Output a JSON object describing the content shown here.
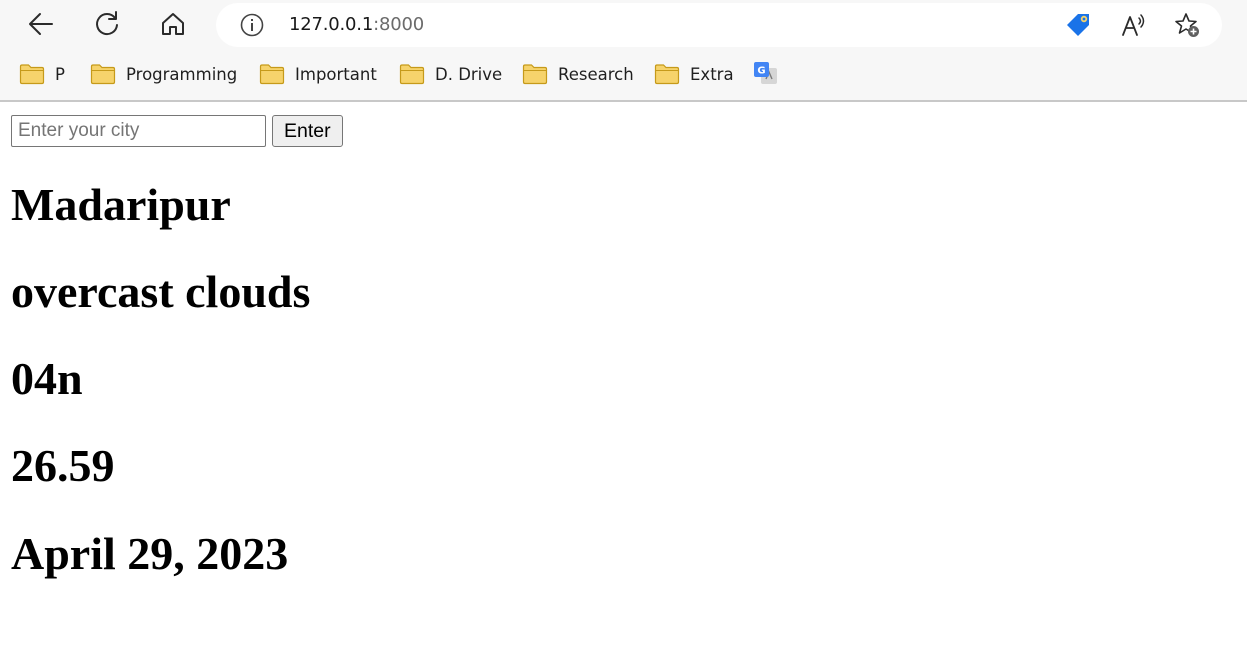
{
  "browser": {
    "url_host": "127.0.0.1",
    "url_port": ":8000",
    "bookmarks": [
      {
        "label": "P",
        "icon": "folder-icon"
      },
      {
        "label": "Programming",
        "icon": "folder-icon"
      },
      {
        "label": "Important",
        "icon": "folder-icon"
      },
      {
        "label": "D. Drive",
        "icon": "folder-icon"
      },
      {
        "label": "Research",
        "icon": "folder-icon"
      },
      {
        "label": "Extra",
        "icon": "folder-icon"
      }
    ],
    "colors": {
      "tag_blue": "#1A73E8",
      "folder_yellow": "#F6D36B",
      "folder_border": "#C69A1A"
    }
  },
  "form": {
    "city_placeholder": "Enter your city",
    "city_value": "",
    "submit_label": "Enter"
  },
  "weather": {
    "city": "Madaripur",
    "description": "overcast clouds",
    "icon_code": "04n",
    "temperature": "26.59",
    "date": "April 29, 2023"
  }
}
